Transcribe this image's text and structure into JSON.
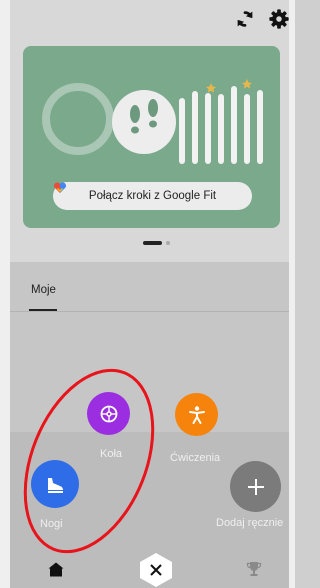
{
  "google_fit": {
    "connect_label": "Połącz kroki z Google Fit"
  },
  "tabs": {
    "mine": "Moje"
  },
  "fab_menu": {
    "wheels": "Koła",
    "exercises": "Ćwiczenia",
    "legs": "Nogi",
    "add_manually": "Dodaj ręcznie"
  },
  "colors": {
    "card": "#7ba98c",
    "wheels": "#9b2ee0",
    "exercises": "#f5830c",
    "legs": "#2f6de8",
    "add": "#7b7b7b",
    "annotation": "#e8141b"
  },
  "icons": {
    "sync": "sync-icon",
    "settings": "gear-icon",
    "steps": "footprints-icon",
    "heart": "google-fit-heart-icon",
    "wheels": "wheel-icon",
    "exercises": "exercise-person-icon",
    "legs": "shoe-icon",
    "add": "plus-icon",
    "home": "home-icon",
    "close": "close-icon",
    "trophy": "trophy-icon"
  }
}
